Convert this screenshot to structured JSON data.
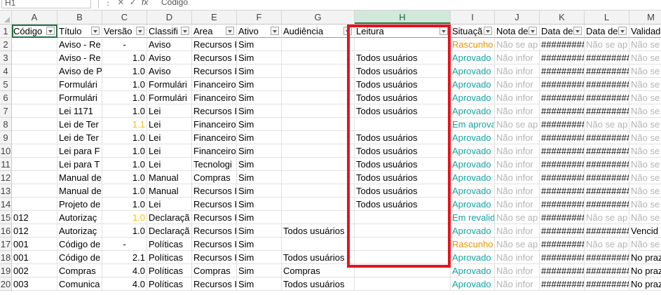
{
  "formula_bar": {
    "name_box": "H1",
    "icons": "⋮ ✕ ✓",
    "fx": "fx",
    "formula": "Código"
  },
  "columns": [
    "A",
    "B",
    "C",
    "D",
    "E",
    "F",
    "G",
    "H",
    "I",
    "J",
    "K",
    "L",
    "M"
  ],
  "selected_column": "H",
  "header_row": {
    "row_number": "1",
    "cells": [
      "Código",
      "Título",
      "Versão",
      "Classifi",
      "Area",
      "Ativo",
      "Audiência",
      "Leitura",
      "Situaçã",
      "Nota de",
      "Data de",
      "Data de",
      "Validad"
    ]
  },
  "rows": [
    {
      "n": "2",
      "A": "",
      "B": "Aviso - Re",
      "C": "-",
      "D": "Aviso",
      "E": "Recursos H",
      "F": "Sim",
      "G": "",
      "H": "",
      "I": "Rascunho",
      "J": "Não se ap",
      "K": "##########",
      "L": "Não se ap",
      "M": "Não se a"
    },
    {
      "n": "3",
      "A": "",
      "B": "Aviso - Re",
      "C": "1.0",
      "D": "Aviso",
      "E": "Recursos H",
      "F": "Sim",
      "G": "",
      "H": "Todos usuários",
      "I": "Aprovado",
      "J": "Não infor",
      "K": "##########",
      "L": "##########",
      "M": "Não se a"
    },
    {
      "n": "4",
      "A": "",
      "B": "Aviso de P",
      "C": "1.0",
      "D": "Aviso",
      "E": "Recursos H",
      "F": "Sim",
      "G": "",
      "H": "Todos usuários",
      "I": "Aprovado",
      "J": "Não infor",
      "K": "##########",
      "L": "##########",
      "M": "Não se a"
    },
    {
      "n": "5",
      "A": "",
      "B": "Formulári",
      "C": "1.0",
      "D": "Formulári",
      "E": "Financeiro",
      "F": "Sim",
      "G": "",
      "H": "Todos usuários",
      "I": "Aprovado",
      "J": "Não infor",
      "K": "##########",
      "L": "##########",
      "M": "Não se a"
    },
    {
      "n": "6",
      "A": "",
      "B": "Formulári",
      "C": "1.0",
      "D": "Formulári",
      "E": "Financeiro",
      "F": "Sim",
      "G": "",
      "H": "Todos usuários",
      "I": "Aprovado",
      "J": "Não infor",
      "K": "##########",
      "L": "##########",
      "M": "Não se a"
    },
    {
      "n": "7",
      "A": "",
      "B": "Lei 1171",
      "C": "1.0",
      "D": "Lei",
      "E": "Recursos H",
      "F": "Sim",
      "G": "",
      "H": "Todos usuários",
      "I": "Aprovado",
      "J": "Não infor",
      "K": "##########",
      "L": "##########",
      "M": "Não se a"
    },
    {
      "n": "8",
      "A": "",
      "B": "Lei de Ter",
      "C": "1.1",
      "D": "Lei",
      "E": "Financeiro",
      "F": "Sim",
      "G": "",
      "H": "",
      "I": "Em aprova",
      "J": "Não se ap",
      "K": "##########",
      "L": "Não se ap",
      "M": "Não se a"
    },
    {
      "n": "9",
      "A": "",
      "B": "Lei de Ter",
      "C": "1.0",
      "D": "Lei",
      "E": "Financeiro",
      "F": "Sim",
      "G": "",
      "H": "Todos usuários",
      "I": "Aprovado",
      "J": "Não infor",
      "K": "##########",
      "L": "##########",
      "M": "Não se a"
    },
    {
      "n": "10",
      "A": "",
      "B": "Lei para F",
      "C": "1.0",
      "D": "Lei",
      "E": "Financeiro",
      "F": "Sim",
      "G": "",
      "H": "Todos usuários",
      "I": "Aprovado",
      "J": "Não infor",
      "K": "##########",
      "L": "##########",
      "M": "Não se a"
    },
    {
      "n": "11",
      "A": "",
      "B": "Lei para T",
      "C": "1.0",
      "D": "Lei",
      "E": "Tecnologi",
      "F": "Sim",
      "G": "",
      "H": "Todos usuários",
      "I": "Aprovado",
      "J": "Não infor",
      "K": "##########",
      "L": "##########",
      "M": "Não se a"
    },
    {
      "n": "12",
      "A": "",
      "B": "Manual de",
      "C": "1.0",
      "D": "Manual",
      "E": "Compras",
      "F": "Sim",
      "G": "",
      "H": "Todos usuários",
      "I": "Aprovado",
      "J": "Não infor",
      "K": "##########",
      "L": "##########",
      "M": "Não se a"
    },
    {
      "n": "13",
      "A": "",
      "B": "Manual de",
      "C": "1.0",
      "D": "Manual",
      "E": "Recursos H",
      "F": "Sim",
      "G": "",
      "H": "Todos usuários",
      "I": "Aprovado",
      "J": "Não infor",
      "K": "##########",
      "L": "##########",
      "M": "Não se a"
    },
    {
      "n": "14",
      "A": "",
      "B": "Projeto de",
      "C": "1.0",
      "D": "Lei",
      "E": "Recursos H",
      "F": "Sim",
      "G": "",
      "H": "Todos usuários",
      "I": "Aprovado",
      "J": "Não infor",
      "K": "##########",
      "L": "##########",
      "M": "Não se a"
    },
    {
      "n": "15",
      "A": "012",
      "B": "Autorizaç",
      "C": "1.0",
      "D": "Declaraçã",
      "E": "Recursos H",
      "F": "Sim",
      "G": "",
      "H": "",
      "I": "Em revalid",
      "J": "Não se ap",
      "K": "##########",
      "L": "Não se ap",
      "M": "Não se a"
    },
    {
      "n": "16",
      "A": "012",
      "B": "Autorizaç",
      "C": "1.0",
      "D": "Declaraçã",
      "E": "Recursos H",
      "F": "Sim",
      "G": "Todos usuários",
      "H": "",
      "I": "Aprovado",
      "J": "Não infor",
      "K": "##########",
      "L": "##########",
      "M": "Vencid"
    },
    {
      "n": "17",
      "A": "001",
      "B": "Código de",
      "C": "-",
      "D": "Políticas",
      "E": "Recursos H",
      "F": "Sim",
      "G": "",
      "H": "",
      "I": "Rascunho",
      "J": "Não se ap",
      "K": "##########",
      "L": "Não se ap",
      "M": "Não se a"
    },
    {
      "n": "18",
      "A": "001",
      "B": "Código de",
      "C": "2.1",
      "D": "Políticas",
      "E": "Recursos H",
      "F": "Sim",
      "G": "Todos usuários",
      "H": "",
      "I": "Aprovado",
      "J": "Não infor",
      "K": "##########",
      "L": "##########",
      "M": "No praz"
    },
    {
      "n": "19",
      "A": "002",
      "B": "Compras",
      "C": "4.0",
      "D": "Políticas",
      "E": "Compras",
      "F": "Sim",
      "G": "Compras",
      "H": "",
      "I": "Aprovado",
      "J": "Não infor",
      "K": "##########",
      "L": "##########",
      "M": "No praz"
    },
    {
      "n": "20",
      "A": "003",
      "B": "Comunica",
      "C": "4.0",
      "D": "Políticas",
      "E": "Recursos H",
      "F": "Sim",
      "G": "Todos usuários",
      "H": "",
      "I": "Aprovado",
      "J": "Não infor",
      "K": "##########",
      "L": "##########",
      "M": "No praz"
    }
  ],
  "colors": {
    "rascunho": "#e69500",
    "aprovado": "#14a3a3",
    "nao_se_aplica": "#b3b3b3",
    "version_pending": "#f2c200",
    "highlight_box": "#e3141f",
    "selected_column_header": "#d2e8da"
  }
}
